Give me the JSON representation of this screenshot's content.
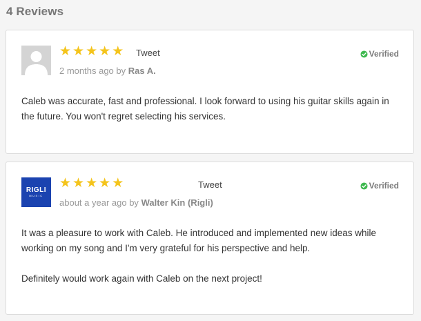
{
  "heading": "4 Reviews",
  "reviews": [
    {
      "avatar_type": "default-user",
      "rating": 5,
      "tweet_label": "Tweet",
      "verified_label": "Verified",
      "time": "2 months ago",
      "by": "by",
      "author": "Ras A.",
      "paragraphs": [
        "Caleb was accurate, fast and professional. I look forward to using his guitar skills again in the future. You won't regret selecting his services."
      ]
    },
    {
      "avatar_type": "brand-logo",
      "avatar_text": "RIGLI",
      "avatar_subtext": "MUSIC",
      "rating": 5,
      "tweet_label": "Tweet",
      "verified_label": "Verified",
      "time": "about a year ago",
      "by": "by",
      "author": "Walter Kin (Rigli)",
      "paragraphs": [
        "It was a pleasure to work with Caleb. He introduced and implemented new ideas while working on my song and I'm very grateful for his perspective and help.",
        "Definitely would work again with Caleb on the next project!"
      ]
    }
  ],
  "colors": {
    "star": "#f4c41c",
    "verified_check": "#3fb950",
    "brand_avatar": "#1b43b0"
  },
  "icons": {
    "star": "star-icon",
    "check": "check-circle-icon",
    "avatar": "user-silhouette-icon"
  }
}
